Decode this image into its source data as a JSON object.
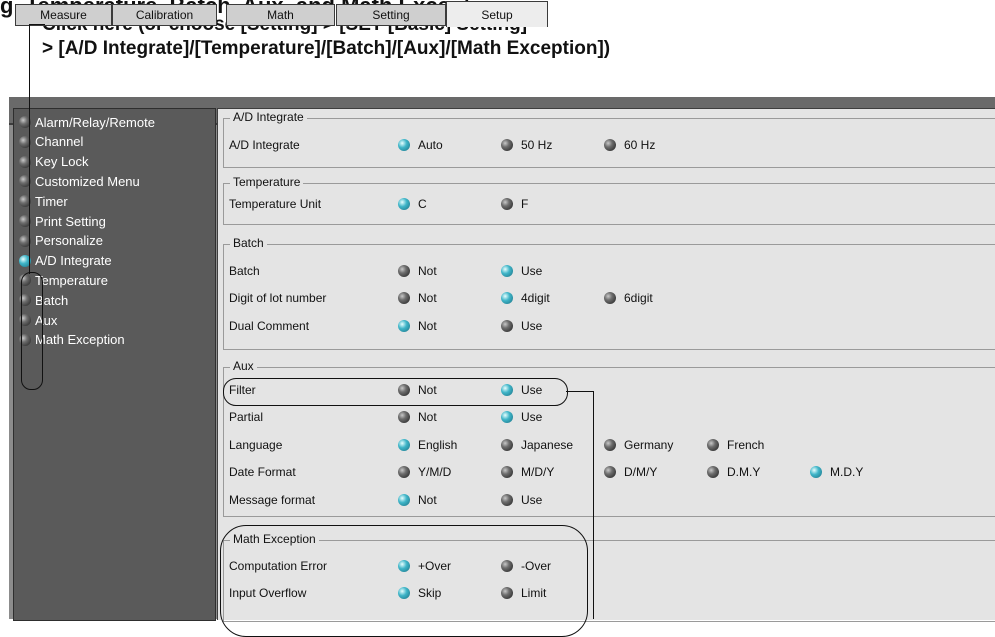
{
  "header": {
    "partial_title": "g, Temperature, Batch, Aux, and Math Exception",
    "instruction_line1": "Click here (or choose [Setting] > [SET [Basic] Setting]",
    "instruction_line2": "> [A/D Integrate]/[Temperature]/[Batch]/[Aux]/[Math Exception])"
  },
  "tabs": [
    "Measure",
    "Calibration",
    "Math",
    "Setting",
    "Setup"
  ],
  "active_tab": "Setup",
  "sidebar": {
    "items": [
      {
        "label": "Alarm/Relay/Remote",
        "state": "off"
      },
      {
        "label": "Channel",
        "state": "off"
      },
      {
        "label": "Key Lock",
        "state": "off"
      },
      {
        "label": "Customized Menu",
        "state": "off"
      },
      {
        "label": "Timer",
        "state": "off"
      },
      {
        "label": "Print Setting",
        "state": "off"
      },
      {
        "label": "Personalize",
        "state": "off"
      },
      {
        "label": "A/D Integrate",
        "state": "on"
      },
      {
        "label": "Temperature",
        "state": "off"
      },
      {
        "label": "Batch",
        "state": "off"
      },
      {
        "label": "Aux",
        "state": "off"
      },
      {
        "label": "Math Exception",
        "state": "off"
      }
    ]
  },
  "groups": {
    "ad": {
      "title": "A/D Integrate",
      "rows": [
        {
          "label": "A/D Integrate",
          "options": [
            "Auto",
            "50 Hz",
            "60 Hz"
          ],
          "selected": "Auto"
        }
      ]
    },
    "temp": {
      "title": "Temperature",
      "rows": [
        {
          "label": "Temperature Unit",
          "options": [
            "C",
            "F"
          ],
          "selected": "C"
        }
      ]
    },
    "batch": {
      "title": "Batch",
      "rows": [
        {
          "label": "Batch",
          "options": [
            "Not",
            "Use"
          ],
          "selected": "Use"
        },
        {
          "label": "Digit of lot number",
          "options": [
            "Not",
            "4digit",
            "6digit"
          ],
          "selected": "4digit"
        },
        {
          "label": "Dual Comment",
          "options": [
            "Not",
            "Use"
          ],
          "selected": "Not"
        }
      ]
    },
    "aux": {
      "title": "Aux",
      "rows": [
        {
          "label": "Filter",
          "options": [
            "Not",
            "Use"
          ],
          "selected": "Use"
        },
        {
          "label": "Partial",
          "options": [
            "Not",
            "Use"
          ],
          "selected": "Use"
        },
        {
          "label": "Language",
          "options": [
            "English",
            "Japanese",
            "Germany",
            "French"
          ],
          "selected": "English"
        },
        {
          "label": "Date Format",
          "options": [
            "Y/M/D",
            "M/D/Y",
            "D/M/Y",
            "D.M.Y",
            "M.D.Y"
          ],
          "selected": "M.D.Y"
        },
        {
          "label": "Message format",
          "options": [
            "Not",
            "Use"
          ],
          "selected": "Not"
        }
      ]
    },
    "math": {
      "title": "Math Exception",
      "rows": [
        {
          "label": "Computation Error",
          "options": [
            "+Over",
            "-Over"
          ],
          "selected": "+Over"
        },
        {
          "label": "Input Overflow",
          "options": [
            "Skip",
            "Limit"
          ],
          "selected": "Skip"
        }
      ]
    }
  },
  "colors": {
    "led_on": "#3fb5c8",
    "led_off": "#2a2a2a",
    "sidebar_bg": "#5a5a5a",
    "panel_bg": "#e4e4e4"
  }
}
